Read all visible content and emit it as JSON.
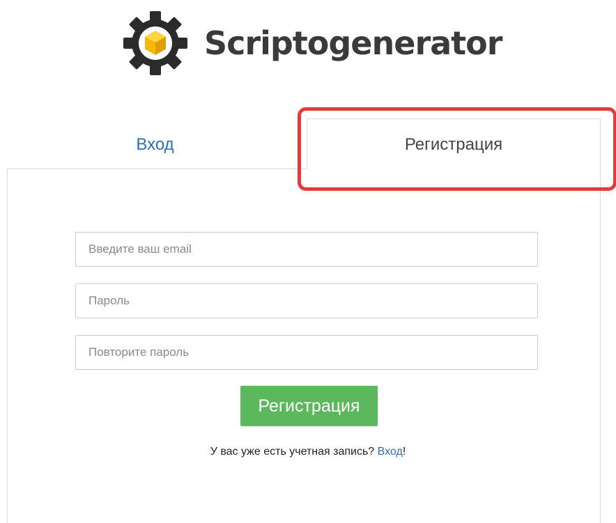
{
  "brand": {
    "name": "Scriptogenerator",
    "icon": "gear-cube-logo-icon",
    "colors": {
      "gear": "#2b2b2b",
      "cube": "#f5b800",
      "text": "#3a3a3a"
    }
  },
  "tabs": [
    {
      "label": "Вход",
      "active": false
    },
    {
      "label": "Регистрация",
      "active": true
    }
  ],
  "form": {
    "email_placeholder": "Введите ваш email",
    "password_placeholder": "Пароль",
    "password_repeat_placeholder": "Повторите пароль",
    "submit_label": "Регистрация"
  },
  "footer": {
    "text": "У вас уже есть учетная запись?",
    "link_label": "Вход",
    "suffix": "!"
  },
  "accent_colors": {
    "link": "#2f6db4",
    "button": "#5cb85c",
    "highlight": "#e03c3c"
  }
}
